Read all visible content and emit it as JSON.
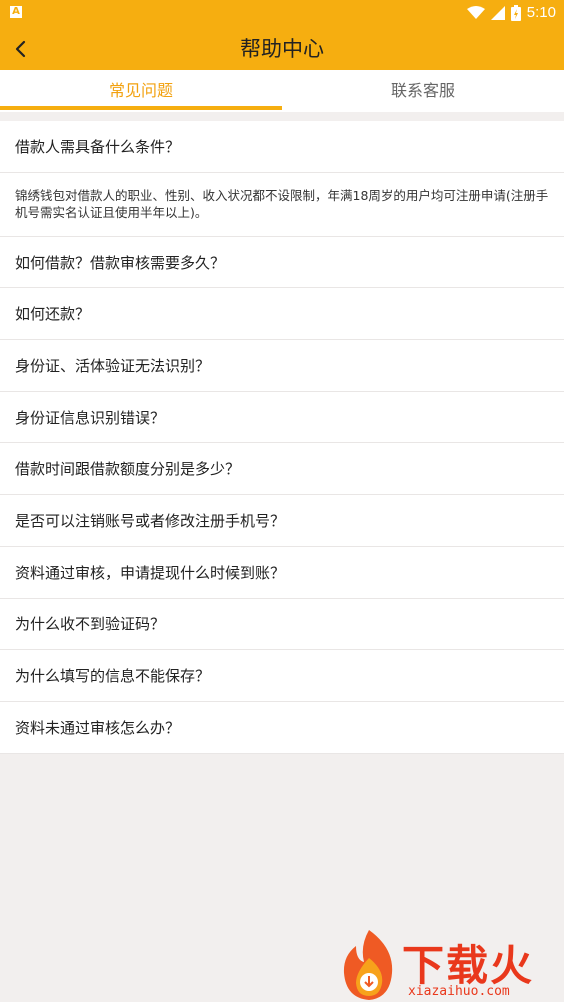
{
  "statusbar": {
    "time": "5:10",
    "app_icon": "A"
  },
  "header": {
    "title": "帮助中心"
  },
  "tabs": [
    {
      "label": "常见问题"
    },
    {
      "label": "联系客服"
    }
  ],
  "faq": {
    "items": [
      {
        "text": "借款人需具备什么条件？"
      },
      {
        "text": "锦绣钱包对借款人的职业、性别、收入状况都不设限制，年满18周岁的用户均可注册申请(注册手机号需实名认证且使用半年以上)。"
      },
      {
        "text": "如何借款？借款审核需要多久？"
      },
      {
        "text": "如何还款？"
      },
      {
        "text": "身份证、活体验证无法识别？"
      },
      {
        "text": "身份证信息识别错误？"
      },
      {
        "text": "借款时间跟借款额度分别是多少？"
      },
      {
        "text": "是否可以注销账号或者修改注册手机号？"
      },
      {
        "text": "资料通过审核，申请提现什么时候到账？"
      },
      {
        "text": "为什么收不到验证码？"
      },
      {
        "text": "为什么填写的信息不能保存？"
      },
      {
        "text": "资料未通过审核怎么办？"
      }
    ]
  },
  "watermark": {
    "text": "下载火",
    "url": "xiazaihuo.com"
  },
  "colors": {
    "brand": "#f6ae10",
    "active_tab": "#f2a10f",
    "background": "#f2efee"
  }
}
